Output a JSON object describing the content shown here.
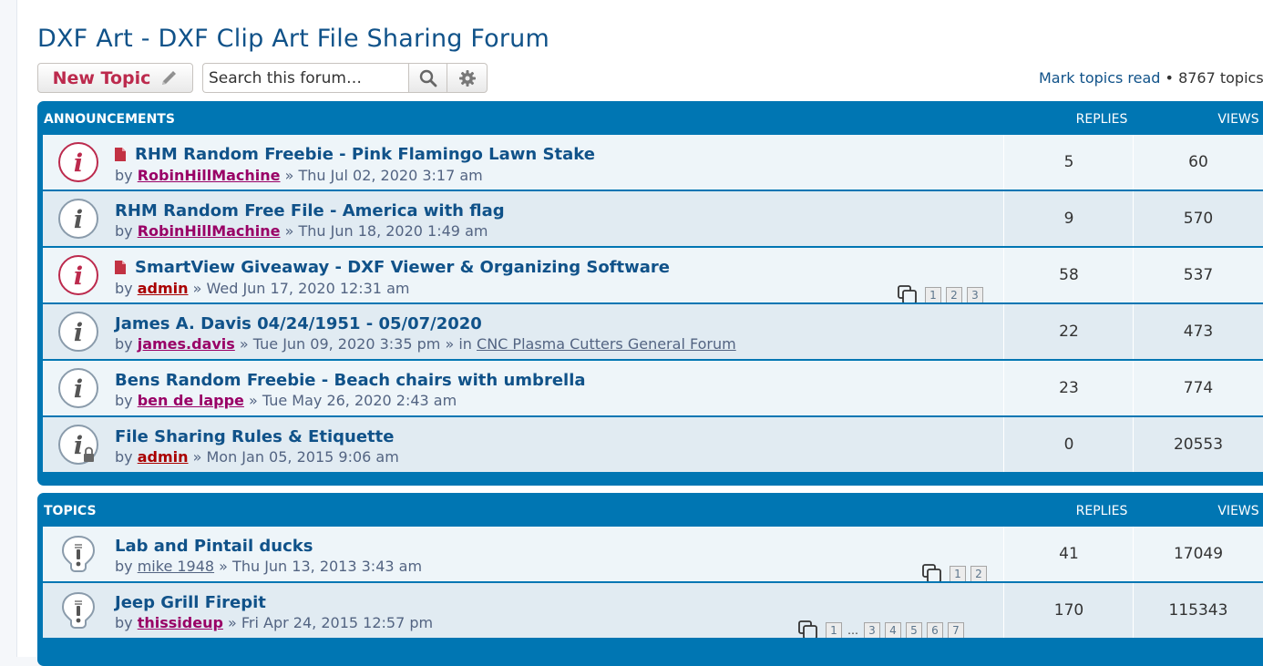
{
  "forum": {
    "title": "DXF Art - DXF Clip Art File Sharing Forum",
    "new_topic_label": "New Topic",
    "search_placeholder": "Search this forum…",
    "mark_read": "Mark topics read",
    "topic_count": " • 8767 topics"
  },
  "announcements": {
    "heading": "ANNOUNCEMENTS",
    "replies_heading": "REPLIES",
    "views_heading": "VIEWS",
    "rows": [
      {
        "title": "RHM Random Freebie - Pink Flamingo Lawn Stake",
        "by": "by ",
        "author": "RobinHillMachine",
        "date": " » Thu Jul 02, 2020 3:17 am",
        "replies": "5",
        "views": "60",
        "icon": "unread-global-announce-icon"
      },
      {
        "title": "RHM Random Free File - America with flag",
        "by": "by ",
        "author": "RobinHillMachine",
        "date": " » Thu Jun 18, 2020 1:49 am",
        "replies": "9",
        "views": "570",
        "icon": "read-announce-icon"
      },
      {
        "title": "SmartView Giveaway - DXF Viewer & Organizing Software",
        "by": "by ",
        "author": "admin",
        "date": " » Wed Jun 17, 2020 12:31 am",
        "replies": "58",
        "views": "537",
        "icon": "unread-global-announce-icon",
        "pages": [
          "1",
          "2",
          "3"
        ]
      },
      {
        "title": "James A. Davis 04/24/1951 - 05/07/2020",
        "by": "by ",
        "author": "james.davis",
        "date": " » Tue Jun 09, 2020 3:35 pm",
        "in": " » in ",
        "forum": "CNC Plasma Cutters General Forum",
        "replies": "22",
        "views": "473",
        "icon": "read-announce-icon"
      },
      {
        "title": "Bens Random Freebie - Beach chairs with umbrella",
        "by": "by ",
        "author": "ben de lappe",
        "date": " » Tue May 26, 2020 2:43 am",
        "replies": "23",
        "views": "774",
        "icon": "read-announce-icon"
      },
      {
        "title": "File Sharing Rules & Etiquette",
        "by": "by ",
        "author": "admin",
        "date": " » Mon Jan 05, 2015 9:06 am",
        "replies": "0",
        "views": "20553",
        "icon": "locked-announce-icon"
      }
    ]
  },
  "topics": {
    "heading": "TOPICS",
    "replies_heading": "REPLIES",
    "views_heading": "VIEWS",
    "rows": [
      {
        "title": "Lab and Pintail ducks",
        "by": "by ",
        "author": "mike 1948",
        "date": " » Thu Jun 13, 2013 3:43 am",
        "replies": "41",
        "views": "17049",
        "pages": [
          "1",
          "2"
        ]
      },
      {
        "title": "Jeep Grill Firepit",
        "by": "by ",
        "author": "thissideup",
        "date": " » Fri Apr 24, 2015 12:57 pm",
        "replies": "170",
        "views": "115343",
        "pages": [
          "1",
          "…",
          "3",
          "4",
          "5",
          "6",
          "7"
        ]
      }
    ]
  },
  "colors": {
    "brand": "#105289",
    "header": "#0076b3",
    "new_topic": "#bc2a4d",
    "unread_icon": "#bc2a4d"
  }
}
